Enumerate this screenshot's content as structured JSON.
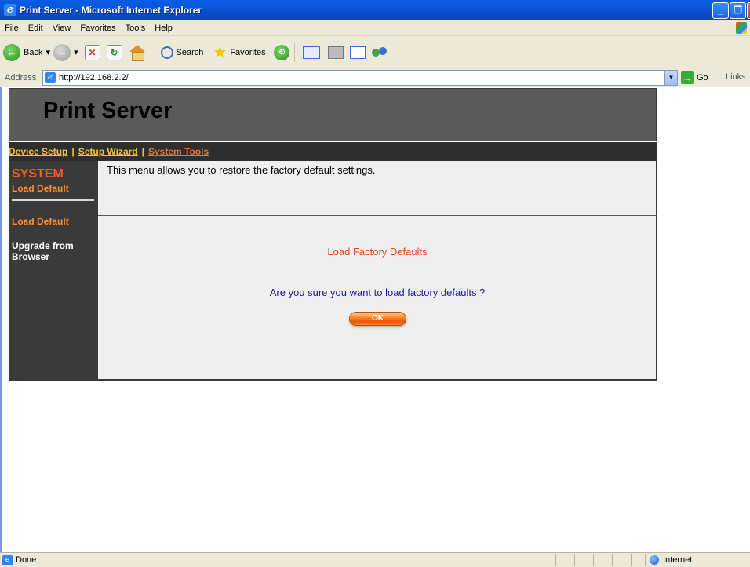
{
  "window": {
    "title": "Print Server - Microsoft Internet Explorer"
  },
  "menubar": {
    "items": [
      "File",
      "Edit",
      "View",
      "Favorites",
      "Tools",
      "Help"
    ]
  },
  "toolbar": {
    "back_label": "Back",
    "search_label": "Search",
    "favorites_label": "Favorites"
  },
  "addressbar": {
    "label": "Address",
    "url": "http://192.168.2.2/",
    "go_label": "Go",
    "links_label": "Links"
  },
  "page": {
    "banner_title": "Print Server",
    "nav": {
      "device_setup": "Device Setup",
      "separator": "|",
      "setup_wizard": "Setup Wizard",
      "system_tools": "System Tools"
    },
    "sidebar": {
      "section_title": "SYSTEM",
      "section_sub": "Load Default",
      "item_load_default": "Load Default",
      "item_upgrade": "Upgrade from Browser"
    },
    "description": "This menu allows you to restore the factory default settings.",
    "main": {
      "heading": "Load Factory Defaults",
      "question": "Are you sure you want to load factory defaults ?",
      "ok_label": "OK"
    }
  },
  "statusbar": {
    "status": "Done",
    "zone": "Internet"
  },
  "colors": {
    "titlebar": "#0a5ce6",
    "banner_bg": "#5a5a5a",
    "nav_bg": "#2e2e2e",
    "nav_link": "#f4c03a",
    "nav_active": "#e8782a",
    "sidebar_bg": "#3a3a3a",
    "sidebar_accent": "#ff5a1a",
    "heading_red": "#e2461c",
    "question_blue": "#1a1aa6",
    "ok_orange": "#ff8b2a"
  }
}
